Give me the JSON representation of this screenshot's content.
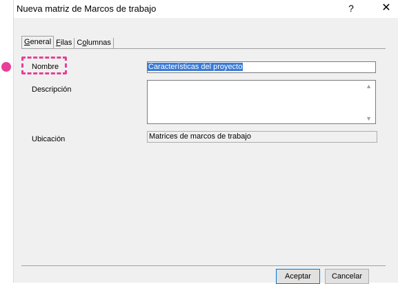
{
  "window": {
    "title": "Nueva matriz de Marcos de trabajo",
    "help": "?",
    "close": "✕"
  },
  "tabs": [
    {
      "pre": "",
      "u": "G",
      "post": "eneral"
    },
    {
      "pre": "",
      "u": "F",
      "post": "ilas"
    },
    {
      "pre": "C",
      "u": "o",
      "post": "lumnas"
    }
  ],
  "form": {
    "name_label": "Nombre",
    "name_value": "Características del proyecto",
    "description_label": "Descripción",
    "description_value": "",
    "location_label": "Ubicación",
    "location_value": "Matrices de marcos de trabajo"
  },
  "buttons": {
    "ok": "Aceptar",
    "cancel": "Cancelar"
  },
  "colors": {
    "highlight": "#e83e97",
    "selection": "#3a7bd5"
  }
}
